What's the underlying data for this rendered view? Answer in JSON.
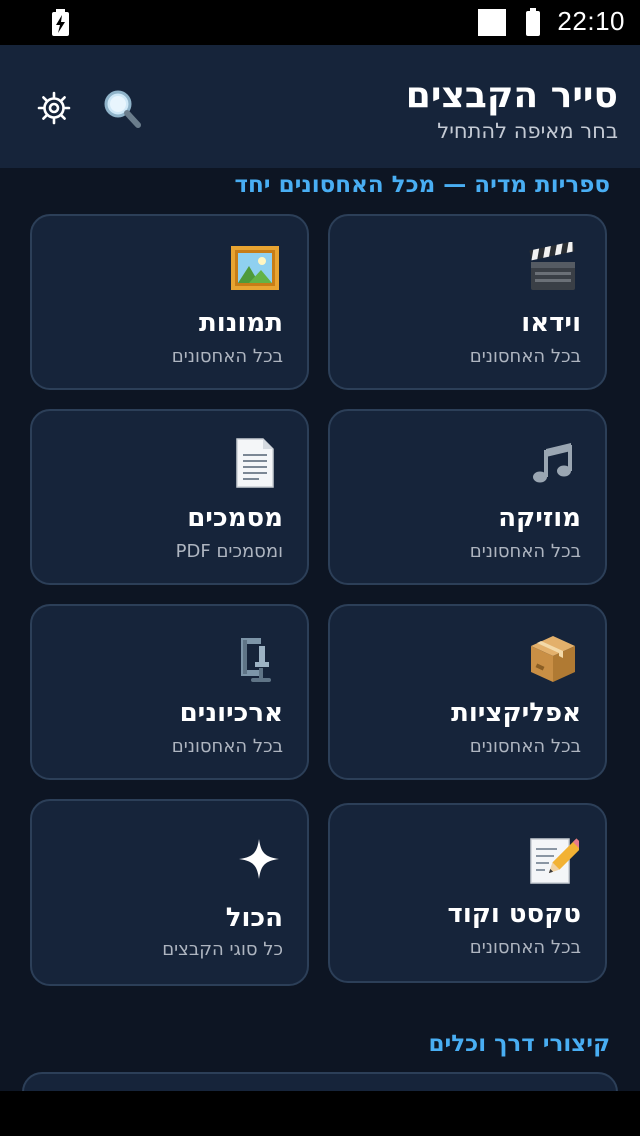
{
  "status_bar": {
    "time": "22:10",
    "icons": [
      "charging-icon",
      "notification-square-icon",
      "battery-icon"
    ]
  },
  "app_bar": {
    "title": "סייר הקבצים",
    "subtitle": "בחר מאיפה להתחיל",
    "actions": [
      "settings-icon",
      "search-icon"
    ]
  },
  "section_media": {
    "title": "ספריות מדיה — מכל האחסונים יחד"
  },
  "cards": [
    {
      "title": "וידאו",
      "subtitle": "בכל האחסונים",
      "icon": "clapperboard-icon"
    },
    {
      "title": "תמונות",
      "subtitle": "בכל האחסונים",
      "icon": "framed-picture-icon"
    },
    {
      "title": "מוזיקה",
      "subtitle": "בכל האחסונים",
      "icon": "music-note-icon"
    },
    {
      "title": "מסמכים",
      "subtitle": "ומסמכים PDF",
      "icon": "document-icon"
    },
    {
      "title": "אפליקציות",
      "subtitle": "בכל האחסונים",
      "icon": "package-icon"
    },
    {
      "title": "ארכיונים",
      "subtitle": "בכל האחסונים",
      "icon": "compression-clamp-icon"
    },
    {
      "title": "טקסט וקוד",
      "subtitle": "בכל האחסונים",
      "icon": "memo-pencil-icon"
    },
    {
      "title": "הכול",
      "subtitle": "כל סוגי הקבצים",
      "icon": "sparkle-icon"
    }
  ],
  "section_shortcuts": {
    "title": "קיצורי דרך וכלים"
  },
  "colors": {
    "background": "#0d1523",
    "surface": "#16243a",
    "card_border": "#2c3f58",
    "accent": "#49aef3",
    "secondary_text": "#aeb5c0"
  }
}
